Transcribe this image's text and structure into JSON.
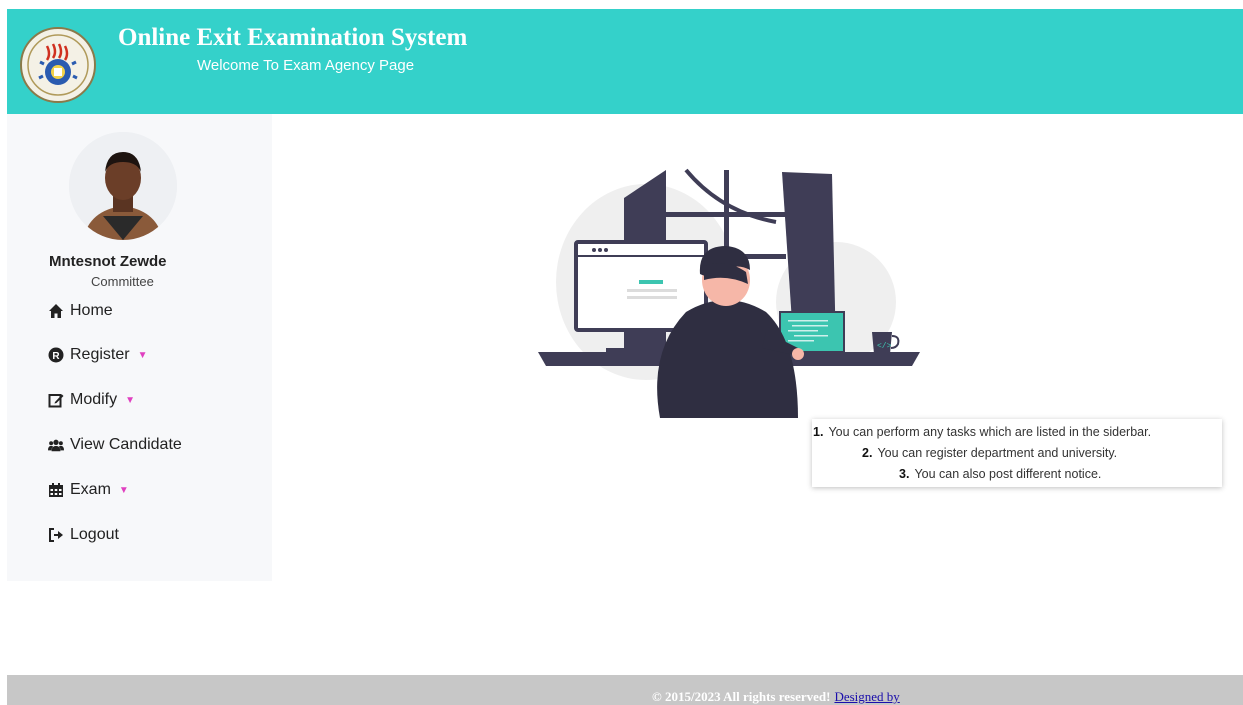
{
  "header": {
    "title": "Online Exit Examination System",
    "subtitle": "Welcome To Exam Agency Page",
    "background_color": "#34d1ca",
    "logo_icon": "university-seal-logo"
  },
  "sidebar": {
    "user": {
      "name": "Mntesnot Zewde",
      "role": "Committee",
      "avatar_icon": "user-avatar"
    },
    "items": [
      {
        "label": "Home",
        "icon": "home-icon",
        "dropdown": false
      },
      {
        "label": "Register",
        "icon": "registered-icon",
        "dropdown": true
      },
      {
        "label": "Modify",
        "icon": "edit-icon",
        "dropdown": true
      },
      {
        "label": "View Candidate",
        "icon": "users-icon",
        "dropdown": false
      },
      {
        "label": "Exam",
        "icon": "calendar-icon",
        "dropdown": true
      },
      {
        "label": "Logout",
        "icon": "logout-icon",
        "dropdown": false
      }
    ],
    "caret_color": "#e040c0"
  },
  "main": {
    "illustration": "person-working-at-computer",
    "instructions": [
      {
        "number": "1.",
        "text": "You can perform any tasks which are listed in the siderbar."
      },
      {
        "number": "2.",
        "text": "You can register department and university."
      },
      {
        "number": "3.",
        "text": "You can also post different notice."
      }
    ]
  },
  "footer": {
    "text": "© 2015/2023 All rights reserved!",
    "link_text": "Designed by",
    "background_color": "#c7c7c7"
  }
}
